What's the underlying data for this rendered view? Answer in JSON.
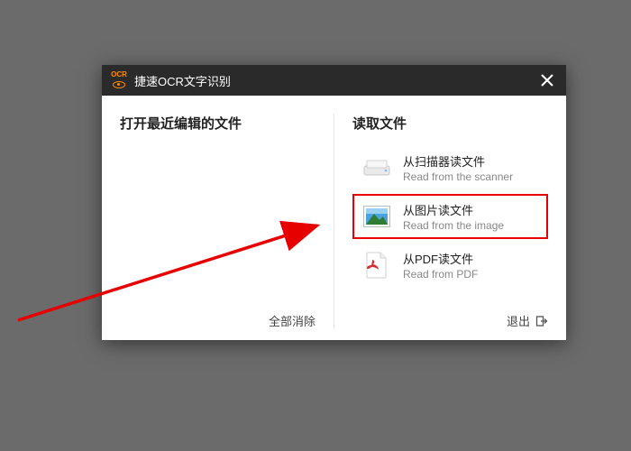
{
  "titlebar": {
    "app_title": "捷速OCR文字识别"
  },
  "left": {
    "header": "打开最近编辑的文件",
    "clear_all": "全部消除"
  },
  "right": {
    "header": "读取文件",
    "options": {
      "scanner": {
        "title": "从扫描器读文件",
        "sub": "Read from the scanner"
      },
      "image": {
        "title": "从图片读文件",
        "sub": "Read from the image"
      },
      "pdf": {
        "title": "从PDF读文件",
        "sub": "Read from PDF"
      }
    },
    "exit": "退出"
  }
}
